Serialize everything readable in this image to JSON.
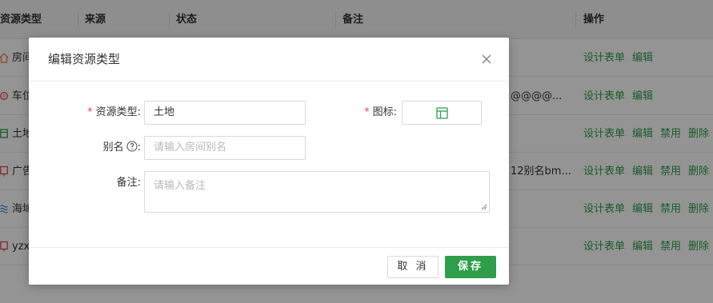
{
  "table": {
    "headers": {
      "type": "资源类型",
      "source": "来源",
      "status": "状态",
      "note": "备注",
      "actions": "操作"
    },
    "rows": [
      {
        "name": "房间",
        "note": "",
        "ops": [
          "设计表单",
          "编辑"
        ]
      },
      {
        "name": "车位",
        "note": "@@@@...",
        "ops": [
          "设计表单",
          "编辑"
        ]
      },
      {
        "name": "土地",
        "note": "",
        "ops": [
          "设计表单",
          "编辑",
          "禁用",
          "删除"
        ]
      },
      {
        "name": "广告",
        "note": "12别名bm...",
        "ops": [
          "设计表单",
          "编辑",
          "禁用",
          "删除"
        ]
      },
      {
        "name": "海域",
        "note": "",
        "ops": [
          "设计表单",
          "编辑",
          "禁用",
          "删除"
        ]
      },
      {
        "name": "yzx",
        "note": "",
        "ops": [
          "设计表单",
          "编辑",
          "禁用",
          "删除"
        ]
      }
    ],
    "row_icon_colors": [
      "#e8833a",
      "#e5484d",
      "#2e9e4a",
      "#e5484d",
      "#3b8fd6",
      "#e5484d"
    ]
  },
  "modal": {
    "title": "编辑资源类型",
    "fields": {
      "type_label": "资源类型:",
      "type_value": "土地",
      "icon_label": "图标:",
      "alias_label": "别名",
      "alias_placeholder": "请输入房间别名",
      "note_label": "备注:",
      "note_placeholder": "请输入备注"
    },
    "buttons": {
      "cancel": "取 消",
      "save": "保存"
    }
  },
  "colors": {
    "accent": "#2e9e4a",
    "required": "#e5484d"
  }
}
